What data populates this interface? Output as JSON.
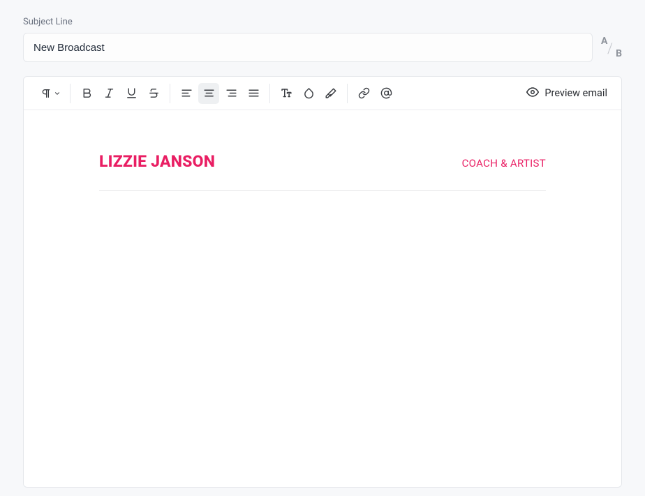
{
  "subject": {
    "label": "Subject Line",
    "value": "New Broadcast"
  },
  "toolbar": {
    "preview_label": "Preview email"
  },
  "email": {
    "title": "LIZZIE JANSON",
    "subtitle": "COACH & ARTIST"
  },
  "colors": {
    "accent": "#e91e63"
  }
}
